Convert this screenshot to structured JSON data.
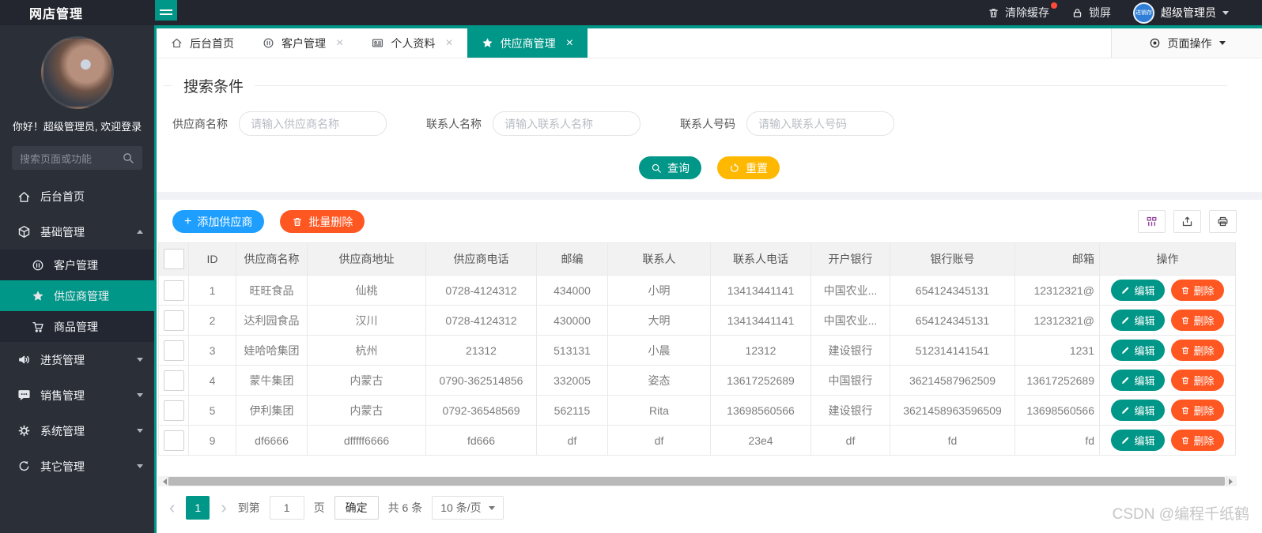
{
  "theme": {
    "teal": "#009688",
    "blue": "#1E9FFF",
    "red": "#FF5722",
    "yellow": "#FFB800"
  },
  "header": {
    "logo": "网店管理",
    "clear_cache": "清除缓存",
    "lock_screen": "锁屏",
    "avatar_text": "进销存",
    "user": "超级管理员"
  },
  "sidebar": {
    "greeting": "你好！超级管理员, 欢迎登录",
    "search_placeholder": "搜索页面或功能",
    "menu": [
      {
        "label": "后台首页",
        "icon": "home-icon",
        "type": "root"
      },
      {
        "label": "基础管理",
        "icon": "cube-icon",
        "type": "parent",
        "expanded": true,
        "children": [
          {
            "label": "客户管理",
            "icon": "pause-circle-icon",
            "active": false
          },
          {
            "label": "供应商管理",
            "icon": "star-icon",
            "active": true
          },
          {
            "label": "商品管理",
            "icon": "cart-icon",
            "active": false
          }
        ]
      },
      {
        "label": "进货管理",
        "icon": "volume-icon",
        "type": "parent",
        "expanded": false
      },
      {
        "label": "销售管理",
        "icon": "comment-icon",
        "type": "parent",
        "expanded": false
      },
      {
        "label": "系统管理",
        "icon": "gear-icon",
        "type": "parent",
        "expanded": false
      },
      {
        "label": "其它管理",
        "icon": "cycle-icon",
        "type": "parent",
        "expanded": false
      }
    ]
  },
  "tabs": {
    "items": [
      {
        "label": "后台首页",
        "icon": "home-icon",
        "closable": false,
        "active": false
      },
      {
        "label": "客户管理",
        "icon": "pause-circle-icon",
        "closable": true,
        "active": false
      },
      {
        "label": "个人资料",
        "icon": "idcard-icon",
        "closable": true,
        "active": false
      },
      {
        "label": "供应商管理",
        "icon": "star-icon",
        "closable": true,
        "active": true
      }
    ],
    "page_actions": "页面操作"
  },
  "search": {
    "legend": "搜索条件",
    "fields": [
      {
        "label": "供应商名称",
        "placeholder": "请输入供应商名称"
      },
      {
        "label": "联系人名称",
        "placeholder": "请输入联系人名称"
      },
      {
        "label": "联系人号码",
        "placeholder": "请输入联系人号码"
      }
    ],
    "query_label": "查询",
    "reset_label": "重置"
  },
  "toolbar": {
    "add_label": "添加供应商",
    "batch_delete_label": "批量删除",
    "tools": [
      "filter-columns-icon",
      "export-icon",
      "print-icon"
    ]
  },
  "table": {
    "columns": [
      "ID",
      "供应商名称",
      "供应商地址",
      "供应商电话",
      "邮编",
      "联系人",
      "联系人电话",
      "开户银行",
      "银行账号",
      "邮箱",
      "操作"
    ],
    "col_keys": [
      "id",
      "name",
      "address",
      "phone",
      "zip",
      "contact",
      "contact_phone",
      "bank",
      "account",
      "email"
    ],
    "rows": [
      {
        "id": "1",
        "name": "旺旺食品",
        "address": "仙桃",
        "phone": "0728-4124312",
        "zip": "434000",
        "contact": "小明",
        "contact_phone": "13413441141",
        "bank": "中国农业...",
        "account": "654124345131",
        "email": "12312321@"
      },
      {
        "id": "2",
        "name": "达利园食品",
        "address": "汉川",
        "phone": "0728-4124312",
        "zip": "430000",
        "contact": "大明",
        "contact_phone": "13413441141",
        "bank": "中国农业...",
        "account": "654124345131",
        "email": "12312321@"
      },
      {
        "id": "3",
        "name": "娃哈哈集团",
        "address": "杭州",
        "phone": "21312",
        "zip": "513131",
        "contact": "小晨",
        "contact_phone": "12312",
        "bank": "建设银行",
        "account": "512314141541",
        "email": "1231"
      },
      {
        "id": "4",
        "name": "蒙牛集团",
        "address": "内蒙古",
        "phone": "0790-362514856",
        "zip": "332005",
        "contact": "姿态",
        "contact_phone": "13617252689",
        "bank": "中国银行",
        "account": "36214587962509",
        "email": "13617252689"
      },
      {
        "id": "5",
        "name": "伊利集团",
        "address": "内蒙古",
        "phone": "0792-36548569",
        "zip": "562115",
        "contact": "Rita",
        "contact_phone": "13698560566",
        "bank": "建设银行",
        "account": "3621458963596509",
        "email": "13698560566"
      },
      {
        "id": "9",
        "name": "df6666",
        "address": "dfffff6666",
        "phone": "fd666",
        "zip": "df",
        "contact": "df",
        "contact_phone": "23e4",
        "bank": "df",
        "account": "fd",
        "email": "fd"
      }
    ],
    "edit_label": "编辑",
    "delete_label": "删除"
  },
  "pagination": {
    "current_page": "1",
    "goto_label": "到第",
    "goto_value": "1",
    "page_label": "页",
    "confirm_label": "确定",
    "total_label": "共 6 条",
    "page_size": "10 条/页"
  },
  "watermark": "CSDN @编程千纸鹤"
}
